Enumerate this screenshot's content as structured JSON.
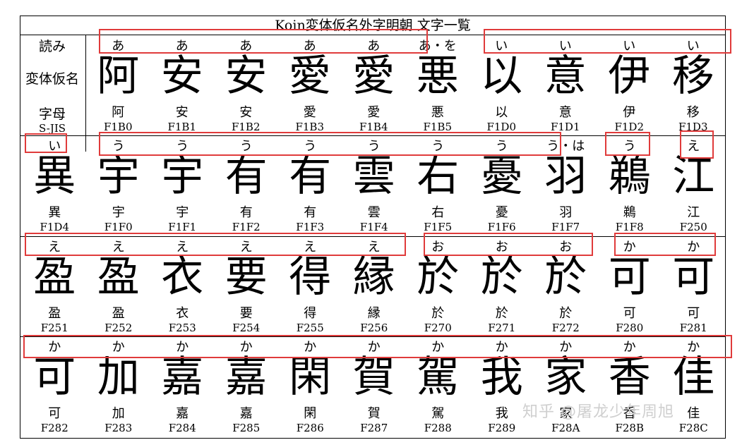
{
  "title": "Koin変体仮名外字明朝 文字一覧",
  "labels": {
    "reading": "読み",
    "glyph": "変体仮名",
    "bofu": "字母",
    "code": "S-JIS"
  },
  "rows": [
    [
      {
        "r": "あ",
        "g": "阿",
        "b": "阿",
        "c": "F1B0"
      },
      {
        "r": "あ",
        "g": "安",
        "b": "安",
        "c": "F1B1"
      },
      {
        "r": "あ",
        "g": "安",
        "b": "安",
        "c": "F1B2"
      },
      {
        "r": "あ",
        "g": "愛",
        "b": "愛",
        "c": "F1B3"
      },
      {
        "r": "あ",
        "g": "愛",
        "b": "愛",
        "c": "F1B4"
      },
      {
        "r": "あ・を",
        "g": "悪",
        "b": "悪",
        "c": "F1B5"
      },
      {
        "r": "い",
        "g": "以",
        "b": "以",
        "c": "F1D0"
      },
      {
        "r": "い",
        "g": "意",
        "b": "意",
        "c": "F1D1"
      },
      {
        "r": "い",
        "g": "伊",
        "b": "伊",
        "c": "F1D2"
      },
      {
        "r": "い",
        "g": "移",
        "b": "移",
        "c": "F1D3"
      }
    ],
    [
      {
        "r": "い",
        "g": "異",
        "b": "異",
        "c": "F1D4"
      },
      {
        "r": "う",
        "g": "宇",
        "b": "宇",
        "c": "F1F0"
      },
      {
        "r": "う",
        "g": "宇",
        "b": "宇",
        "c": "F1F1"
      },
      {
        "r": "う",
        "g": "有",
        "b": "有",
        "c": "F1F2"
      },
      {
        "r": "う",
        "g": "有",
        "b": "有",
        "c": "F1F3"
      },
      {
        "r": "う",
        "g": "雲",
        "b": "雲",
        "c": "F1F4"
      },
      {
        "r": "う",
        "g": "右",
        "b": "右",
        "c": "F1F5"
      },
      {
        "r": "う",
        "g": "憂",
        "b": "憂",
        "c": "F1F6"
      },
      {
        "r": "う・は",
        "g": "羽",
        "b": "羽",
        "c": "F1F7"
      },
      {
        "r": "う",
        "g": "鵜",
        "b": "鵜",
        "c": "F1F8"
      },
      {
        "r": "え",
        "g": "江",
        "b": "江",
        "c": "F250"
      }
    ],
    [
      {
        "r": "え",
        "g": "盈",
        "b": "盈",
        "c": "F251"
      },
      {
        "r": "え",
        "g": "盈",
        "b": "盈",
        "c": "F252"
      },
      {
        "r": "え",
        "g": "衣",
        "b": "衣",
        "c": "F253"
      },
      {
        "r": "え",
        "g": "要",
        "b": "要",
        "c": "F254"
      },
      {
        "r": "え",
        "g": "得",
        "b": "得",
        "c": "F255"
      },
      {
        "r": "え",
        "g": "縁",
        "b": "縁",
        "c": "F256"
      },
      {
        "r": "お",
        "g": "於",
        "b": "於",
        "c": "F270"
      },
      {
        "r": "お",
        "g": "於",
        "b": "於",
        "c": "F271"
      },
      {
        "r": "お",
        "g": "於",
        "b": "於",
        "c": "F272"
      },
      {
        "r": "か",
        "g": "可",
        "b": "可",
        "c": "F280"
      },
      {
        "r": "か",
        "g": "可",
        "b": "可",
        "c": "F281"
      }
    ],
    [
      {
        "r": "か",
        "g": "可",
        "b": "可",
        "c": "F282"
      },
      {
        "r": "か",
        "g": "加",
        "b": "加",
        "c": "F283"
      },
      {
        "r": "か",
        "g": "嘉",
        "b": "嘉",
        "c": "F284"
      },
      {
        "r": "か",
        "g": "嘉",
        "b": "嘉",
        "c": "F285"
      },
      {
        "r": "か",
        "g": "閑",
        "b": "閑",
        "c": "F286"
      },
      {
        "r": "か",
        "g": "賀",
        "b": "賀",
        "c": "F287"
      },
      {
        "r": "か",
        "g": "駕",
        "b": "駕",
        "c": "F288"
      },
      {
        "r": "か",
        "g": "我",
        "b": "我",
        "c": "F289"
      },
      {
        "r": "か",
        "g": "家",
        "b": "家",
        "c": "F28A"
      },
      {
        "r": "か",
        "g": "香",
        "b": "香",
        "c": "F28B"
      },
      {
        "r": "か",
        "g": "佳",
        "b": "佳",
        "c": "F28C"
      }
    ]
  ],
  "watermark": "知乎 @屠龙少年周旭",
  "highlight_color": "#e03b3b"
}
